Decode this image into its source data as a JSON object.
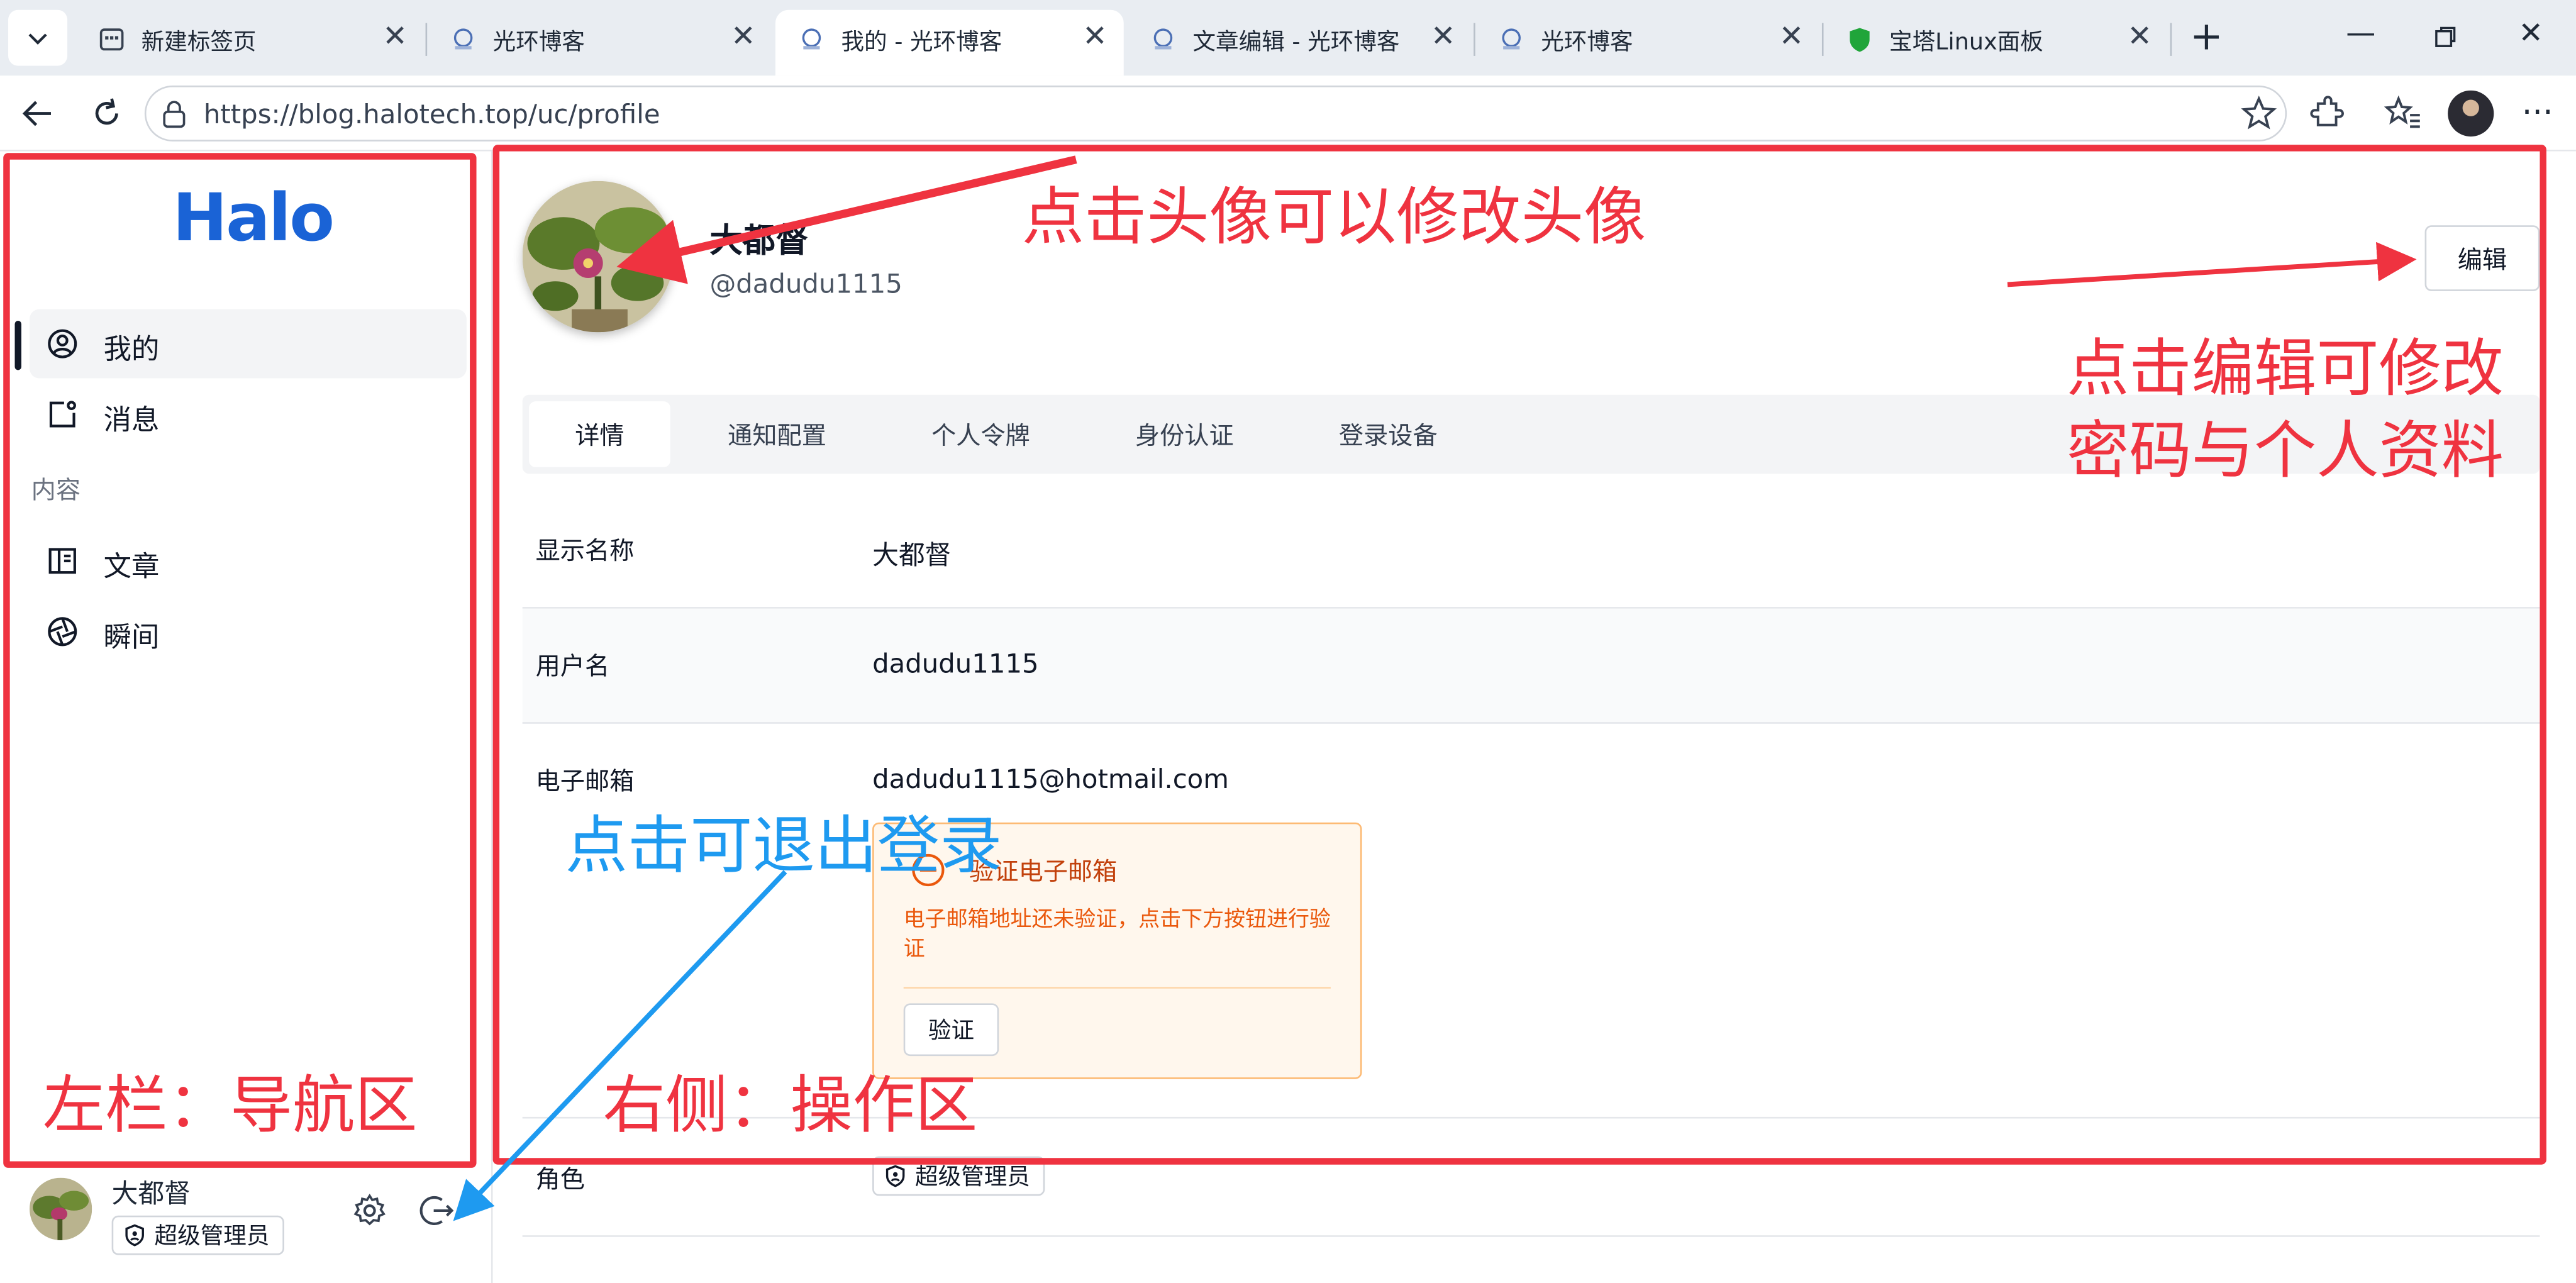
{
  "browser": {
    "tabs": [
      {
        "label": "新建标签页",
        "icon": "new-tab-icon"
      },
      {
        "label": "光环博客",
        "icon": "halo-favicon"
      },
      {
        "label": "我的 - 光环博客",
        "icon": "halo-favicon",
        "active": true
      },
      {
        "label": "文章编辑 - 光环博客",
        "icon": "halo-favicon"
      },
      {
        "label": "光环博客",
        "icon": "halo-favicon"
      },
      {
        "label": "宝塔Linux面板",
        "icon": "baota-shield-icon"
      }
    ],
    "url": "https://blog.halotech.top/uc/profile"
  },
  "sidebar": {
    "logo": "Halo",
    "items": [
      {
        "label": "我的",
        "icon": "user-circle-icon",
        "active": true
      },
      {
        "label": "消息",
        "icon": "message-icon"
      }
    ],
    "group_label": "内容",
    "content_items": [
      {
        "label": "文章",
        "icon": "article-icon"
      },
      {
        "label": "瞬间",
        "icon": "moments-icon"
      }
    ],
    "user": {
      "name": "大都督",
      "role": "超级管理员"
    }
  },
  "profile": {
    "display_name": "大都督",
    "username_handle": "@dadudu1115",
    "edit_label": "编辑",
    "tabs": [
      "详情",
      "通知配置",
      "个人令牌",
      "身份认证",
      "登录设备"
    ],
    "fields": [
      {
        "label": "显示名称",
        "value": "大都督"
      },
      {
        "label": "用户名",
        "value": "dadudu1115"
      },
      {
        "label": "电子邮箱",
        "value": "dadudu1115@hotmail.com"
      },
      {
        "label": "角色",
        "value": "超级管理员"
      }
    ],
    "email_alert": {
      "title": "验证电子邮箱",
      "description": "电子邮箱地址还未验证，点击下方按钮进行验证",
      "button": "验证"
    }
  },
  "annotations": {
    "avatar_hint": "点击头像可以修改头像",
    "edit_hint_line1": "点击编辑可修改",
    "edit_hint_line2": "密码与个人资料",
    "logout_hint": "点击可退出登录",
    "left_label": "左栏：导航区",
    "right_label": "右侧：操作区",
    "red": "#ef3340",
    "blue": "#1e9af0"
  }
}
